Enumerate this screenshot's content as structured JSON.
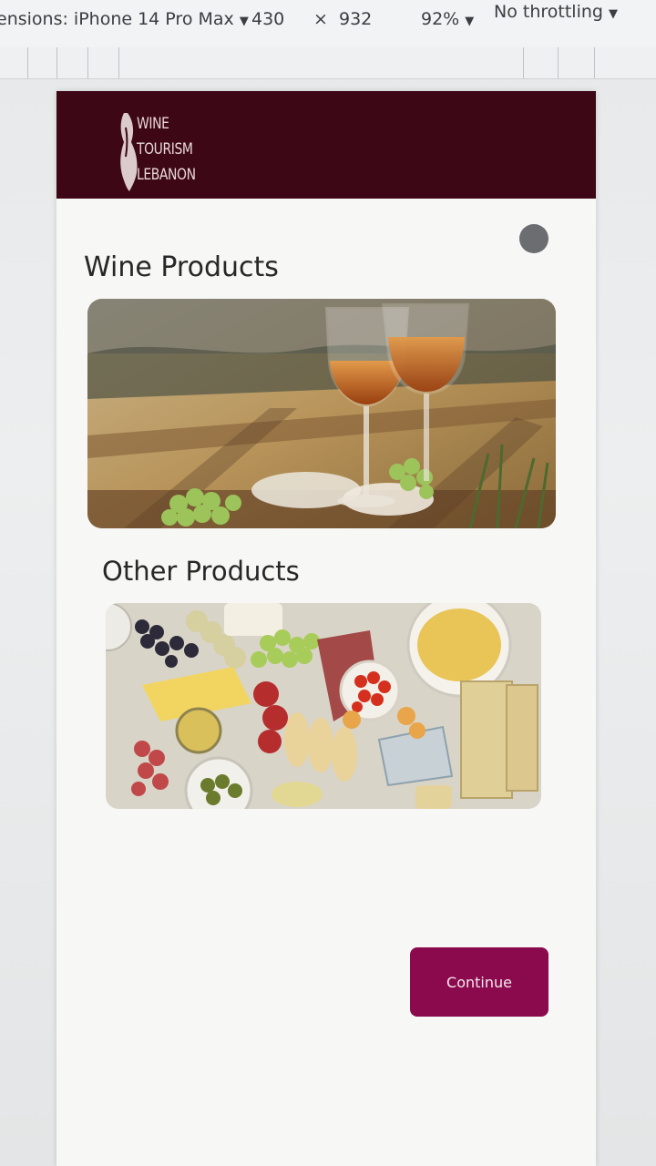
{
  "devtools": {
    "device_label": "ensions: iPhone 14 Pro Max",
    "width_value": "430",
    "times_symbol": "×",
    "height_value": "932",
    "zoom_label": "92%",
    "throttle_label": "No throttling"
  },
  "header": {
    "logo_lines": [
      "WINE",
      "TOURISM",
      "LEBANON"
    ],
    "background_color": "#3d0716"
  },
  "sections": {
    "wine_title": "Wine Products",
    "other_title": "Other Products"
  },
  "images": {
    "wine_photo": "wine-glasses-picnic",
    "other_photo": "charcuterie-board"
  },
  "actions": {
    "continue_label": "Continue",
    "accent_color": "#8b0a4e"
  }
}
